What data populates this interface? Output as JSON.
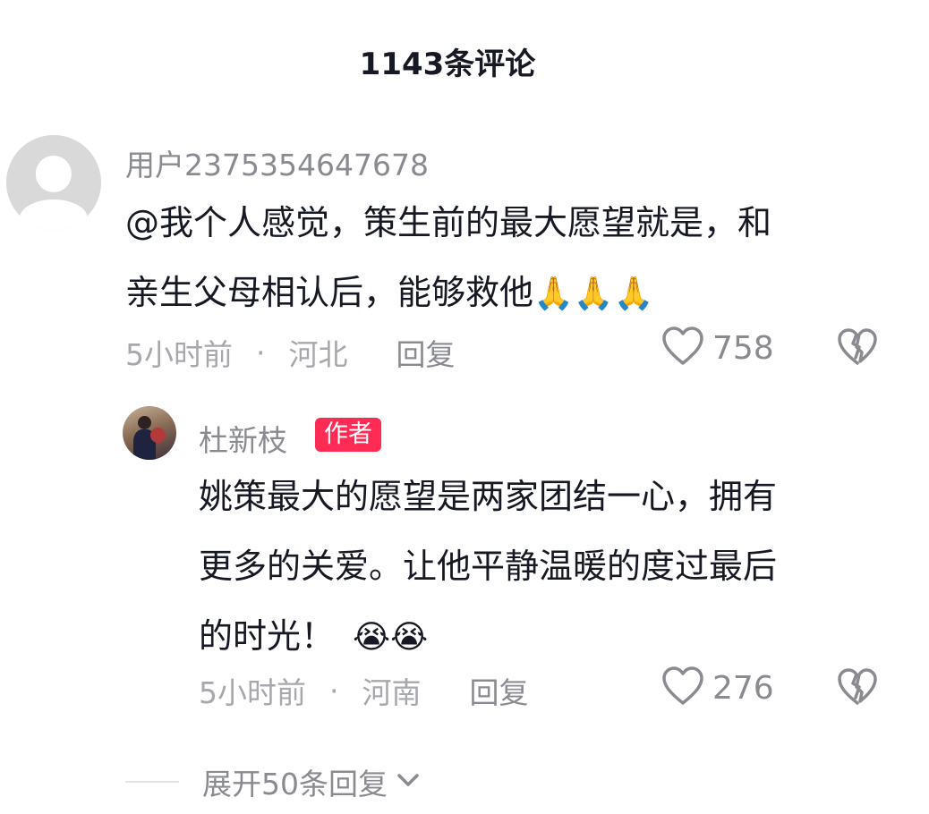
{
  "header": {
    "title": "1143条评论"
  },
  "comments": [
    {
      "username": "用户2375354647678",
      "text_line1": "@我个人感觉，策生前的最大愿望就是，和",
      "text_line2": "亲生父母相认后，能够救他",
      "emoji": "🙏🙏🙏",
      "time": "5小时前",
      "dot": "·",
      "location": "河北",
      "reply_label": "回复",
      "likes": "758"
    }
  ],
  "reply": {
    "username": "杜新枝",
    "badge": "作者",
    "text_line1": "姚策最大的愿望是两家团结一心，拥有",
    "text_line2": "更多的关爱。让他平静温暖的度过最后",
    "text_line3": "的时光！",
    "emoji": "😭😭",
    "time": "5小时前",
    "dot": "·",
    "location": "河南",
    "reply_label": "回复",
    "likes": "276"
  },
  "expand": {
    "label": "展开50条回复"
  },
  "icons": {
    "like": "heart-outline-icon",
    "dislike": "broken-heart-icon",
    "expand": "chevron-down-icon"
  },
  "colors": {
    "badge": "#fe2c55",
    "text": "#161823",
    "muted": "#8a8b91"
  }
}
